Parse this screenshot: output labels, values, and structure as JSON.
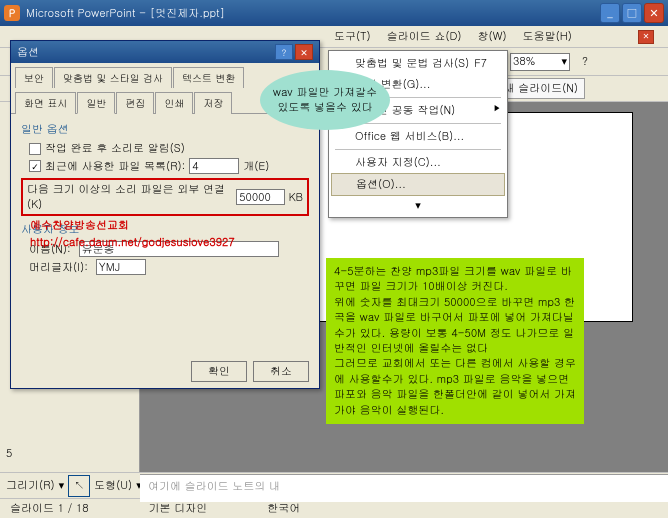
{
  "window": {
    "app": "Microsoft PowerPoint",
    "filename": "[멋진제자.ppt]"
  },
  "menu": {
    "tools": "도구(T)",
    "slideshow": "슬라이드 쇼(D)",
    "window": "창(W)",
    "help": "도움말(H)"
  },
  "toolbar": {
    "zoom": "38%",
    "newslide": "새 슬라이드(N)"
  },
  "dialog": {
    "title": "옵션",
    "tabs": {
      "security": "보안",
      "spelling": "맞춤법 및 스타일 검사",
      "textedit": "텍스트 변환",
      "view": "화면 표시",
      "general": "일반",
      "edit": "편집",
      "print": "인쇄",
      "save": "저장"
    },
    "general_options": "일반 옵션",
    "sound_feedback": "작업 완료 후 소리로 알림(S)",
    "recent_files": "최근에 사용한 파일 목록(R):",
    "recent_count": "4",
    "recent_unit": "개(E)",
    "link_sounds": "다음 크기 이상의 소리 파일은 외부 연결(K)",
    "link_size": "50000",
    "link_unit": "KB",
    "user_info": "사용자 정보",
    "name_label": "이름(N):",
    "name_value": "유문종",
    "initials_label": "머리글자(I):",
    "initials_value": "YMJ",
    "ok": "확인",
    "cancel": "취소"
  },
  "dropdown": {
    "spelling": "맞춤법 및 문법 검사(S)",
    "spelling_key": "F7",
    "hanja": "한자 변환(G)...",
    "online": "온라인 공동 작업(N)",
    "office_web": "Office 웹 서비스(B)...",
    "customize": "사용자 지정(C)...",
    "options": "옵션(O)..."
  },
  "bubble": {
    "text": "wav 파일만 가져갈수 있도록 넣을수 있다"
  },
  "redtext": {
    "line1": "예수찬양방송선교회",
    "line2": "http://cafe.daum.net/godjesuslove3927"
  },
  "greennote": {
    "text": "4-5분하는 찬양 mp3파일 크기를 wav 파일로 바꾸면 파일 크기가 10배이상 커진다.\n위에 숫자를 최대크기 50000으로 바꾸면 mp3 한곡을 wav 파일로 바구어서 파포에 넣어 가져다닐수가 있다. 용량이 보통 4-50M 정도 나가므로 일반적인 인터넷에 올릴수는 없다\n그러므로 교회에서 또는 다른 컴에서 사용할 경우에 사용할수가 있다. mp3 파일로 음악을 넣으면 파포와 음악 파일을 한폴더안에 같이 넣어서 가져가야 음악이 실행된다."
  },
  "notes": {
    "placeholder": "여기에 슬라이드 노트의 내"
  },
  "drawbar": {
    "draw": "그리기(R)",
    "autoshape": "도형(U)"
  },
  "statusbar": {
    "slide": "슬라이드 1 / 18",
    "design": "기본 디자인",
    "lang": "한국어"
  },
  "slidenum": "5"
}
